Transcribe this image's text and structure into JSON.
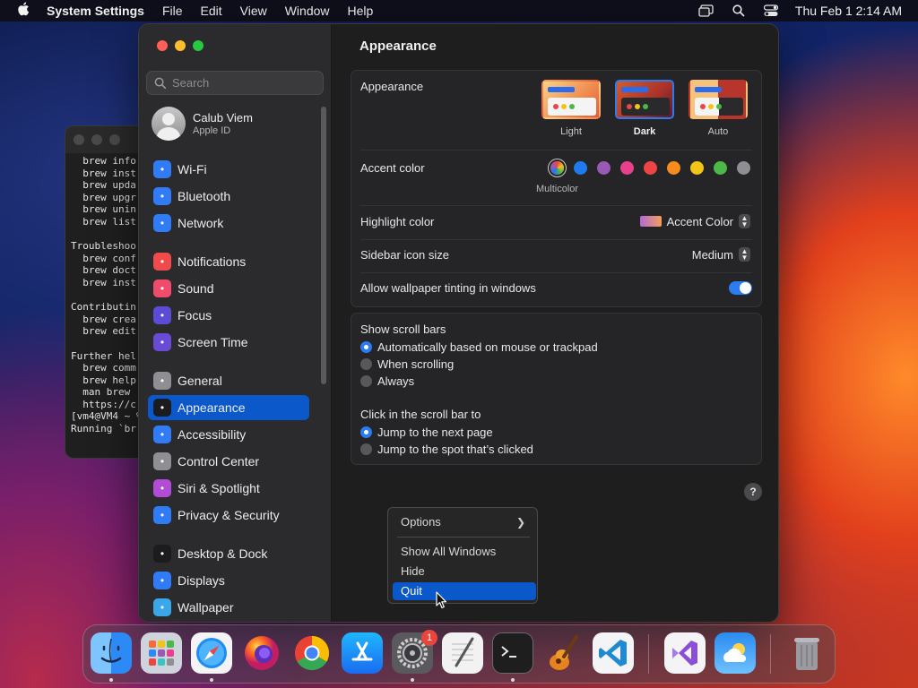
{
  "menubar": {
    "app_name": "System Settings",
    "menus": [
      "File",
      "Edit",
      "View",
      "Window",
      "Help"
    ],
    "clock": "Thu Feb 1  2:14 AM"
  },
  "terminal": {
    "lines": [
      "  brew info",
      "  brew inst",
      "  brew upda",
      "  brew upgr",
      "  brew unin",
      "  brew list",
      "",
      "Troubleshoo",
      "  brew conf",
      "  brew doct",
      "  brew inst",
      "",
      "Contributin",
      "  brew crea",
      "  brew edit",
      "",
      "Further hel",
      "  brew comm",
      "  brew help",
      "  man brew",
      "  https://c",
      "[vm4@VM4 ~ %",
      "Running `br",
      ""
    ]
  },
  "sidebar": {
    "search_placeholder": "Search",
    "account": {
      "name": "Calub Viem",
      "subtitle": "Apple ID"
    },
    "items": [
      {
        "label": "Wi-Fi",
        "icon": "wifi-icon",
        "color": "#2f7cf6"
      },
      {
        "label": "Bluetooth",
        "icon": "bluetooth-icon",
        "color": "#2f7cf6"
      },
      {
        "label": "Network",
        "icon": "globe-icon",
        "color": "#2f7cf6"
      },
      {
        "label": "Notifications",
        "icon": "bell-icon",
        "color": "#ef4b4b"
      },
      {
        "label": "Sound",
        "icon": "speaker-icon",
        "color": "#ef4b6b"
      },
      {
        "label": "Focus",
        "icon": "moon-icon",
        "color": "#5b4bd6"
      },
      {
        "label": "Screen Time",
        "icon": "hourglass-icon",
        "color": "#6a4bd6"
      },
      {
        "label": "General",
        "icon": "gear-icon",
        "color": "#8e8e93"
      },
      {
        "label": "Appearance",
        "icon": "appearance-icon",
        "color": "#1c1c1e"
      },
      {
        "label": "Accessibility",
        "icon": "accessibility-icon",
        "color": "#2f7cf6"
      },
      {
        "label": "Control Center",
        "icon": "control-center-icon",
        "color": "#8e8e93"
      },
      {
        "label": "Siri & Spotlight",
        "icon": "siri-icon",
        "color": "#b24bd6"
      },
      {
        "label": "Privacy & Security",
        "icon": "hand-icon",
        "color": "#2f7cf6"
      },
      {
        "label": "Desktop & Dock",
        "icon": "desktop-icon",
        "color": "#1c1c1e"
      },
      {
        "label": "Displays",
        "icon": "sun-icon",
        "color": "#2f7cf6"
      },
      {
        "label": "Wallpaper",
        "icon": "wallpaper-icon",
        "color": "#3aa7e8"
      }
    ],
    "selected_index": 8
  },
  "main": {
    "title": "Appearance",
    "appearance": {
      "label": "Appearance",
      "options": [
        {
          "label": "Light",
          "selected": false
        },
        {
          "label": "Dark",
          "selected": true
        },
        {
          "label": "Auto",
          "selected": false
        }
      ]
    },
    "accent": {
      "label": "Accent color",
      "selected_label": "Multicolor",
      "colors": [
        "multicolor",
        "#1f7af0",
        "#9b59b6",
        "#e9408e",
        "#ef4444",
        "#f58c1b",
        "#f2c418",
        "#4cb848",
        "#8e8e93"
      ]
    },
    "highlight": {
      "label": "Highlight color",
      "value": "Accent Color"
    },
    "icon_size": {
      "label": "Sidebar icon size",
      "value": "Medium"
    },
    "tinting": {
      "label": "Allow wallpaper tinting in windows",
      "on": true
    },
    "scroll_bars": {
      "label": "Show scroll bars",
      "options": [
        {
          "label": "Automatically based on mouse or trackpad",
          "selected": true
        },
        {
          "label": "When scrolling",
          "selected": false
        },
        {
          "label": "Always",
          "selected": false
        }
      ]
    },
    "click_scroll": {
      "label": "Click in the scroll bar to",
      "options": [
        {
          "label": "Jump to the next page",
          "selected": true
        },
        {
          "label": "Jump to the spot that’s clicked",
          "selected": false
        }
      ]
    },
    "help_label": "?"
  },
  "context_menu": {
    "options_label": "Options",
    "show_all": "Show All Windows",
    "hide": "Hide",
    "quit": "Quit"
  },
  "dock": {
    "apps": [
      "Finder",
      "Launchpad",
      "Safari",
      "Firefox",
      "Chrome",
      "App Store",
      "System Settings",
      "TextEdit",
      "Terminal",
      "GarageBand",
      "Visual Studio Code",
      "Visual Studio",
      "Weather",
      "Trash"
    ],
    "badge_count": "1"
  }
}
